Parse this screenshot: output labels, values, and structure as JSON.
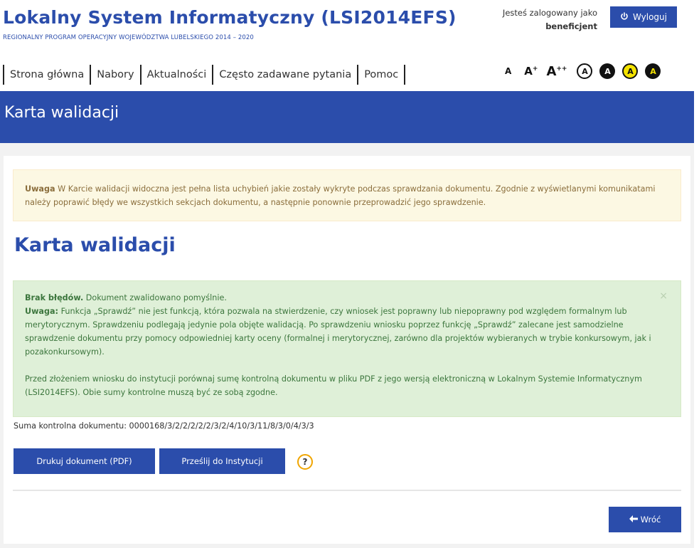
{
  "header": {
    "app_title": "Lokalny System Informatyczny (LSI2014EFS)",
    "app_subtitle": "REGIONALNY PROGRAM OPERACYJNY WOJEWÓDZTWA LUBELSKIEGO 2014 – 2020",
    "logged_in_as": "Jesteś zalogowany jako",
    "role": "beneficjent",
    "logout_label": "Wyloguj"
  },
  "nav": {
    "items": [
      {
        "label": "Strona główna"
      },
      {
        "label": "Nabory"
      },
      {
        "label": "Aktualności"
      },
      {
        "label": "Często zadawane pytania"
      },
      {
        "label": "Pomoc"
      }
    ]
  },
  "accessibility": {
    "font_small": "A",
    "font_medium": "A",
    "font_medium_sup": "+",
    "font_large": "A",
    "font_large_sup": "++",
    "contrast_labels": [
      "A",
      "A",
      "A",
      "A"
    ]
  },
  "banner": {
    "title": "Karta walidacji"
  },
  "warning": {
    "bold": "Uwaga",
    "text": " W Karcie walidacji widoczna jest pełna lista uchybień jakie zostały wykryte podczas sprawdzania dokumentu. Zgodnie z wyświetlanymi komunikatami należy poprawić błędy we wszystkich sekcjach dokumentu, a następnie ponownie przeprowadzić jego sprawdzenie."
  },
  "page_title": "Karta walidacji",
  "success": {
    "close": "×",
    "line1_bold": "Brak błędów.",
    "line1_text": " Dokument zwalidowano pomyślnie.",
    "line2_bold": "Uwaga:",
    "line2_text": " Funkcja „Sprawdź” nie jest funkcją, która pozwala na stwierdzenie, czy wniosek jest poprawny lub niepoprawny pod względem formalnym lub merytorycznym. Sprawdzeniu podlegają jedynie pola objęte walidacją. Po sprawdzeniu wniosku poprzez funkcję „Sprawdź” zalecane jest samodzielne sprawdzenie dokumentu przy pomocy odpowiedniej karty oceny (formalnej i merytorycznej, zarówno dla projektów wybieranych w trybie konkursowym, jak i pozakonkursowym).",
    "line3_text": "Przed złożeniem wniosku do instytucji porównaj sumę kontrolną dokumentu w pliku PDF z jego wersją elektroniczną w Lokalnym Systemie Informatycznym (LSI2014EFS). Obie sumy kontrolne muszą być ze sobą zgodne."
  },
  "checksum": {
    "label": "Suma kontrolna dokumentu: 0000168/3/2/2/2/2/2/3/2/4/10/3/11/8/3/0/4/3/3"
  },
  "buttons": {
    "print_pdf": "Drukuj dokument (PDF)",
    "send": "Prześlij do Instytucji",
    "help": "?",
    "back": "Wróć"
  },
  "colors": {
    "brand": "#2b4dab",
    "warning_bg": "#fcf8e3",
    "success_bg": "#dff0d8",
    "help_ring": "#f0a500"
  }
}
